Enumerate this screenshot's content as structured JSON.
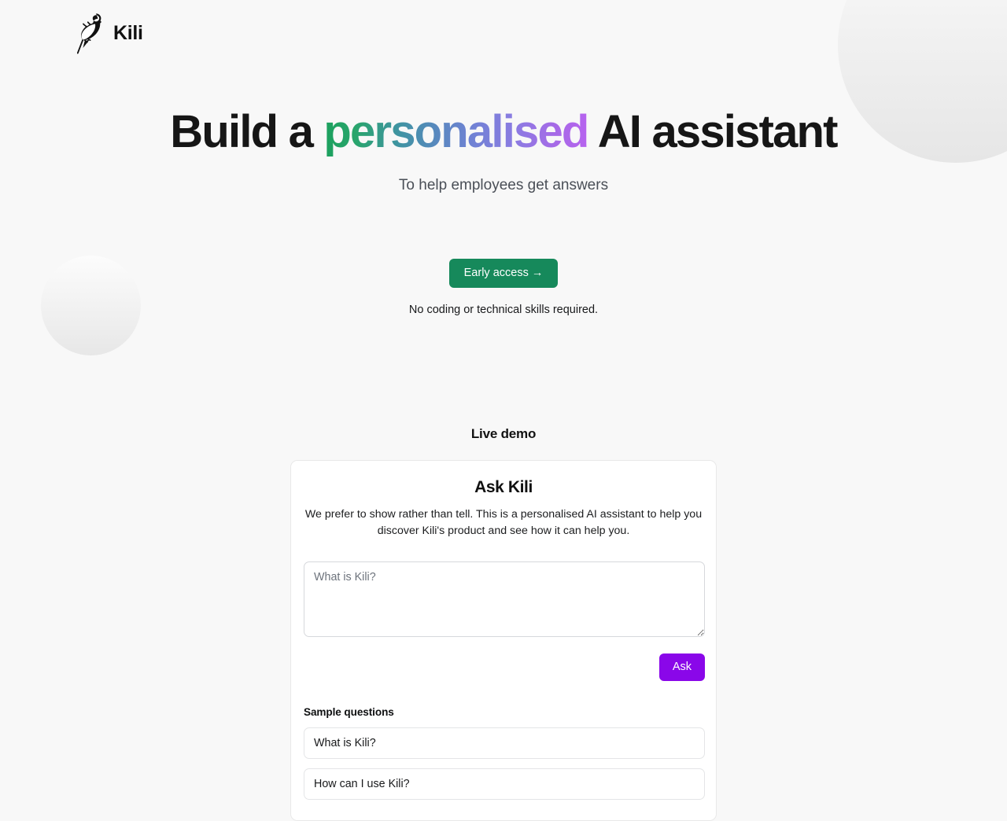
{
  "brand": {
    "name": "Kili",
    "logo_icon": "parrot-bird-icon"
  },
  "hero": {
    "title_part1": "Build a ",
    "title_highlight": "personalised",
    "title_part2": " AI assistant",
    "subtitle": "To help employees get answers",
    "gradient_start": "#1ba05d",
    "gradient_end": "#b763ef"
  },
  "cta": {
    "button_label": "Early access →",
    "button_color": "#16895b",
    "note": "No coding or technical skills required."
  },
  "demo": {
    "section_heading": "Live demo",
    "card_title": "Ask Kili",
    "card_description": "We prefer to show rather than tell. This is a personalised AI assistant to help you discover Kili's product and see how it can help you.",
    "input_placeholder": "What is Kili?",
    "input_value": "",
    "ask_button_label": "Ask",
    "ask_button_color": "#8a07e9",
    "samples_label": "Sample questions",
    "samples": [
      "What is Kili?",
      "How can I use Kili?"
    ]
  }
}
